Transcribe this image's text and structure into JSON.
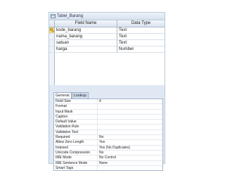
{
  "window": {
    "title": "Tabel_Barang"
  },
  "grid": {
    "headers": {
      "field_name": "Field Name",
      "data_type": "Data Type"
    },
    "rows": [
      {
        "field": "kode_barang",
        "type": "Text",
        "primary_key": true
      },
      {
        "field": "nama_barang",
        "type": "Text",
        "primary_key": false
      },
      {
        "field": "satuan",
        "type": "Text",
        "primary_key": false
      },
      {
        "field": "harga",
        "type": "Number",
        "primary_key": false
      }
    ]
  },
  "properties": {
    "tabs": [
      "General",
      "Lookup"
    ],
    "active_tab": "General",
    "rows": [
      {
        "name": "Field Size",
        "value": "4"
      },
      {
        "name": "Format",
        "value": ""
      },
      {
        "name": "Input Mask",
        "value": ""
      },
      {
        "name": "Caption",
        "value": ""
      },
      {
        "name": "Default Value",
        "value": ""
      },
      {
        "name": "Validation Rule",
        "value": ""
      },
      {
        "name": "Validation Text",
        "value": ""
      },
      {
        "name": "Required",
        "value": "No"
      },
      {
        "name": "Allow Zero Length",
        "value": "Yes"
      },
      {
        "name": "Indexed",
        "value": "Yes (No Duplicates)"
      },
      {
        "name": "Unicode Compression",
        "value": "No"
      },
      {
        "name": "IME Mode",
        "value": "No Control"
      },
      {
        "name": "IME Sentence Mode",
        "value": "None"
      },
      {
        "name": "Smart Tags",
        "value": ""
      }
    ]
  },
  "colors": {
    "accent": "#f0d27a",
    "frame": "#dfe8f3",
    "grid_line": "#aab8cc"
  }
}
